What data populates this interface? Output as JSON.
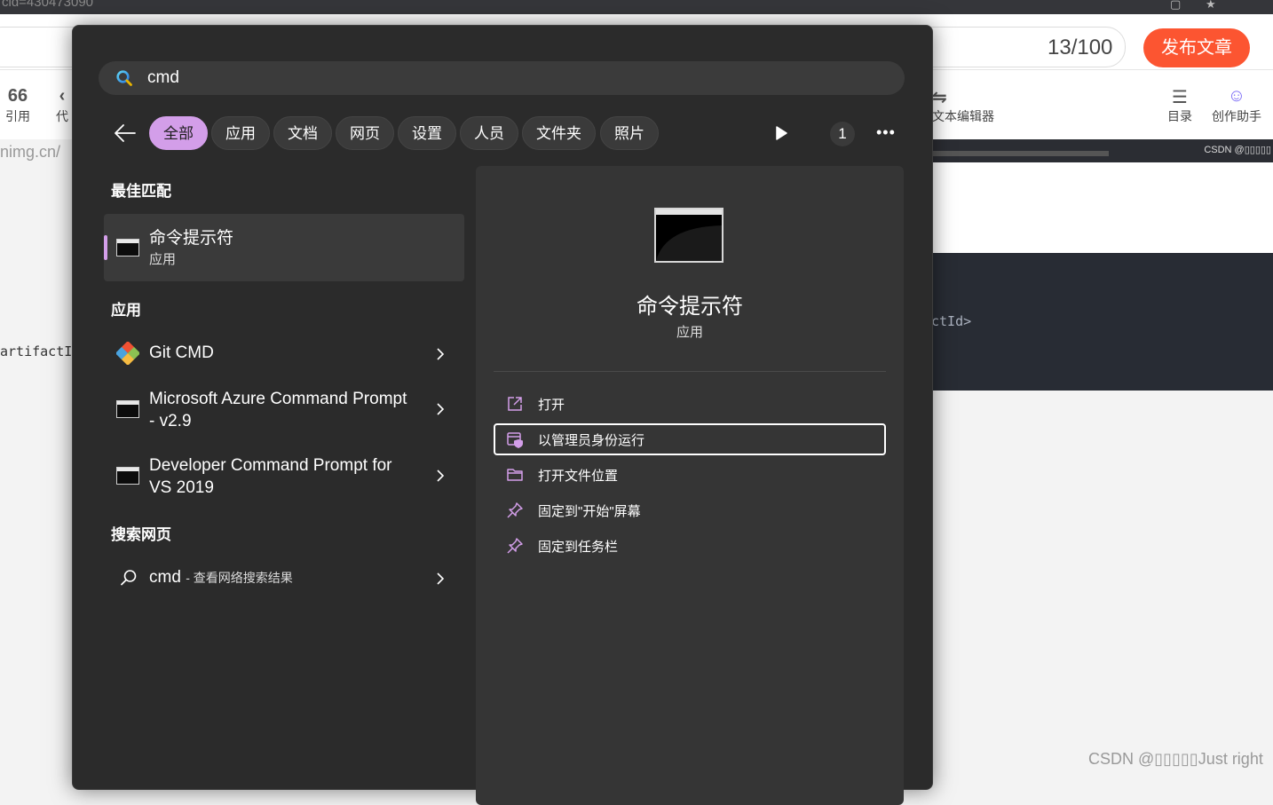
{
  "background": {
    "window_title": "cid=430473090",
    "counter": "13/100",
    "publish_label": "发布文章",
    "toolbar": [
      {
        "glyph": "66",
        "label": "引用"
      },
      {
        "glyph": "‹",
        "label": "代"
      },
      {
        "glyph": "⇋",
        "label": "文本编辑器"
      },
      {
        "glyph": "☰",
        "label": "目录"
      },
      {
        "glyph": "☺",
        "label": "创作助手"
      }
    ],
    "url_fragment": "nimg.cn/",
    "strip_label": "CSDN @▯▯▯▯▯",
    "code_fragment": "ctId>",
    "artifact_fragment": "artifactI",
    "watermark": "CSDN @▯▯▯▯▯Just right"
  },
  "search": {
    "query": "cmd"
  },
  "filters": {
    "tabs": [
      "全部",
      "应用",
      "文档",
      "网页",
      "设置",
      "人员",
      "文件夹",
      "照片"
    ],
    "active_index": 0,
    "badge": "1",
    "more": "•••"
  },
  "sections": {
    "best_match": "最佳匹配",
    "apps": "应用",
    "web": "搜索网页"
  },
  "best_match": {
    "name": "命令提示符",
    "type": "应用"
  },
  "apps": [
    {
      "name": "Git CMD",
      "icon": "git-icon"
    },
    {
      "name": "Microsoft Azure Command Prompt - v2.9",
      "icon": "terminal-icon"
    },
    {
      "name": "Developer Command Prompt for VS 2019",
      "icon": "terminal-icon"
    }
  ],
  "web_search": {
    "query": "cmd",
    "suffix": "- 查看网络搜索结果"
  },
  "detail": {
    "title": "命令提示符",
    "type": "应用",
    "actions": [
      {
        "label": "打开",
        "icon": "open-external-icon"
      },
      {
        "label": "以管理员身份运行",
        "icon": "admin-shield-icon"
      },
      {
        "label": "打开文件位置",
        "icon": "folder-icon"
      },
      {
        "label": "固定到\"开始\"屏幕",
        "icon": "pin-icon"
      },
      {
        "label": "固定到任务栏",
        "icon": "pin-icon"
      }
    ]
  },
  "colors": {
    "accent": "#d39ee9",
    "panel": "#2b2b2b",
    "publish": "#fc5531"
  }
}
